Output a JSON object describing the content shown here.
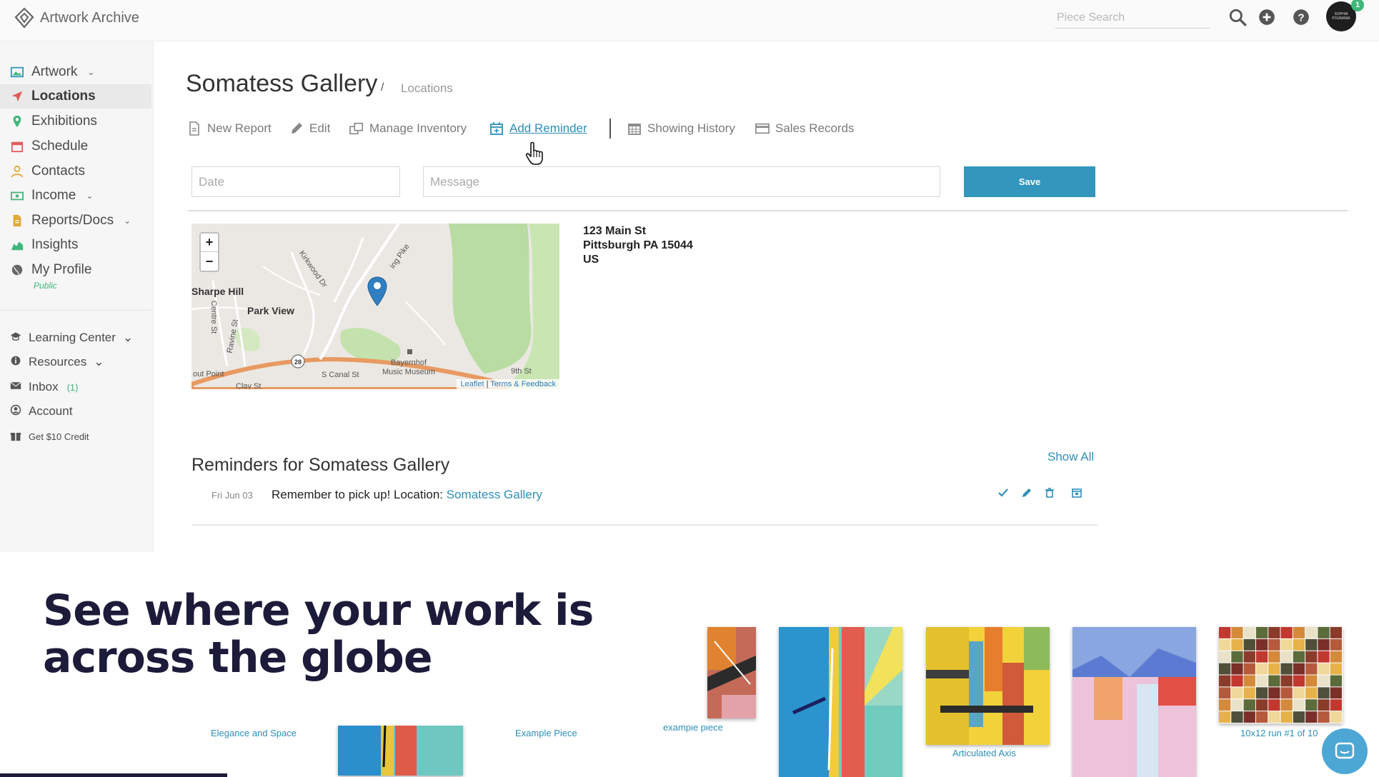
{
  "app": {
    "title": "Artwork Archive"
  },
  "topbar": {
    "search_placeholder": "Piece Search",
    "avatar_text": "SOPHIA POUMANA",
    "notification_count": "1",
    "icons": [
      "search-icon",
      "plus-circle-icon",
      "help-icon"
    ]
  },
  "sidebar": {
    "items": [
      {
        "label": "Artwork",
        "icon": "image-icon",
        "chevron": "⌄"
      },
      {
        "label": "Locations",
        "icon": "location-arrow-icon"
      },
      {
        "label": "Exhibitions",
        "icon": "map-pin-icon"
      },
      {
        "label": "Schedule",
        "icon": "calendar-icon"
      },
      {
        "label": "Contacts",
        "icon": "user-icon"
      },
      {
        "label": "Income",
        "icon": "money-icon",
        "chevron": "⌄"
      },
      {
        "label": "Reports/Docs",
        "icon": "document-icon",
        "chevron": "⌄"
      },
      {
        "label": "Insights",
        "icon": "chart-icon"
      },
      {
        "label": "My Profile",
        "icon": "globe-icon"
      }
    ],
    "profile_sub": "Public",
    "secondary": [
      {
        "label": "Learning Center",
        "icon": "graduation-cap-icon",
        "chevron": "⌄"
      },
      {
        "label": "Resources",
        "icon": "info-icon",
        "chevron": "⌄"
      },
      {
        "label": "Inbox",
        "icon": "envelope-icon",
        "count": "(1)"
      },
      {
        "label": "Account",
        "icon": "user-circle-icon"
      },
      {
        "label": "Get $10 Credit",
        "icon": "gift-icon"
      }
    ]
  },
  "page": {
    "title": "Somatess Gallery",
    "breadcrumb_sep": "/",
    "breadcrumb_link": "Locations"
  },
  "actions": [
    {
      "label": "New Report",
      "icon": "file-icon"
    },
    {
      "label": "Edit",
      "icon": "pencil-icon"
    },
    {
      "label": "Manage Inventory",
      "icon": "copy-icon"
    },
    {
      "label": "Add Reminder",
      "icon": "calendar-plus-icon"
    },
    {
      "label": "Showing History",
      "icon": "calendar-grid-icon"
    },
    {
      "label": "Sales Records",
      "icon": "credit-card-icon"
    }
  ],
  "reminder_form": {
    "date_placeholder": "Date",
    "message_placeholder": "Message",
    "save_label": "Save"
  },
  "map": {
    "zoom_in": "+",
    "zoom_out": "−",
    "places": [
      "Sharpe Hill",
      "Park View"
    ],
    "streets": [
      "Kirkwood Dr",
      "Centre St",
      "Ravine St",
      "S Canal St",
      "9th St",
      "Clay St",
      "ing Pike",
      "out Point",
      "Bayernhof Music Museum"
    ],
    "route_number": "28",
    "attribution": {
      "leaflet": "Leaflet",
      "sep": " | ",
      "terms": "Terms & Feedback"
    }
  },
  "address": {
    "line1": "123 Main St",
    "line2": "Pittsburgh PA 15044",
    "line3": "US"
  },
  "reminders": {
    "title": "Reminders for Somatess Gallery",
    "show_all": "Show All",
    "items": [
      {
        "date": "Fri Jun 03",
        "text": "Remember to pick up! Location: ",
        "link": "Somatess Gallery"
      }
    ],
    "row_icons": [
      "check-icon",
      "pencil-icon",
      "trash-icon",
      "calendar-icon"
    ]
  },
  "banner": {
    "line1": "See where your work is",
    "line2": "across the globe"
  },
  "artworks": [
    {
      "caption": "Elegance and Space"
    },
    {
      "caption": "Example Piece"
    },
    {
      "caption": "example piece"
    },
    {
      "caption": "Articulated Axis"
    },
    {
      "caption": "10x12 run #1 of 10"
    }
  ],
  "colors": {
    "accent": "#3296bd",
    "link": "#2e8fb8",
    "green": "#3fb77a",
    "headline": "#1c1b3a"
  }
}
